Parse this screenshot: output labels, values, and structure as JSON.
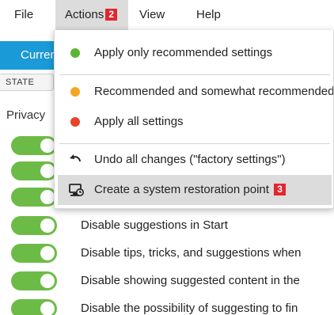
{
  "menubar": {
    "file": "File",
    "actions": "Actions",
    "actions_badge": "2",
    "view": "View",
    "help": "Help"
  },
  "app": {
    "current_tab": "Current",
    "state_label": "STATE",
    "section_label": "Privacy"
  },
  "settings_rows": [
    {
      "label": "Disable suggestions in Start",
      "enabled": true
    },
    {
      "label": "Disable tips, tricks, and suggestions when",
      "enabled": true
    },
    {
      "label": "Disable showing suggested content in the",
      "enabled": true
    },
    {
      "label": "Disable the possibility of suggesting to fin",
      "enabled": true
    }
  ],
  "dropdown": {
    "items": [
      {
        "label": "Apply only recommended settings",
        "dot_color": "#5cb531"
      },
      {
        "label": "Recommended and somewhat recommended",
        "dot_color": "#f5a623"
      },
      {
        "label": "Apply all settings",
        "dot_color": "#e8442a"
      },
      {
        "label": "Undo all changes (\"factory settings\")",
        "icon": "undo-icon"
      },
      {
        "label": "Create a system restoration point",
        "icon": "restore-point-icon",
        "badge": "3"
      }
    ]
  },
  "colors": {
    "accent": "#1a9ad6",
    "toggle_on": "#6dbb47",
    "badge": "#e3262e"
  }
}
